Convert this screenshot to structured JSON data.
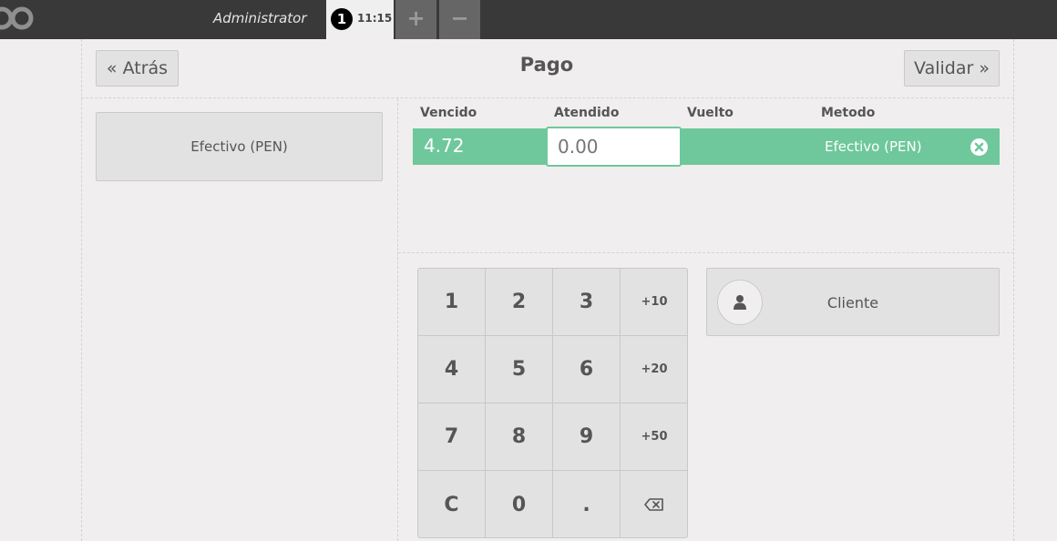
{
  "topbar": {
    "user_name": "Administrator",
    "order": {
      "number": "1",
      "time": "11:15"
    },
    "add_order_label": "+",
    "remove_order_label": "−"
  },
  "header": {
    "back_label": "« Atrás",
    "title": "Pago",
    "validate_label": "Validar »"
  },
  "payment_methods": [
    {
      "label": "Efectivo (PEN)"
    }
  ],
  "paymentlines": {
    "columns": [
      "Vencido",
      "Atendido",
      "Vuelto",
      "Metodo"
    ],
    "rows": [
      {
        "due": "4.72",
        "tendered_placeholder": "0.00",
        "change": "",
        "method": "Efectivo (PEN)"
      }
    ]
  },
  "numpad": {
    "keys": [
      "1",
      "2",
      "3",
      "+10",
      "4",
      "5",
      "6",
      "+20",
      "7",
      "8",
      "9",
      "+50",
      "C",
      "0",
      ".",
      "⌫"
    ]
  },
  "customer": {
    "label": "Cliente"
  },
  "colors": {
    "accent": "#6ec89b",
    "topbar": "#393939",
    "background": "#f0eeee",
    "button": "#e2e2e2"
  }
}
